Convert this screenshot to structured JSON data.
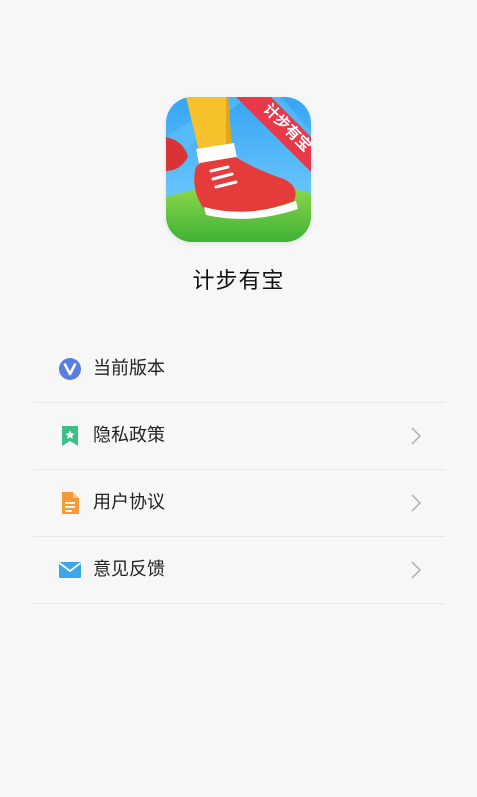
{
  "app": {
    "name": "计步有宝",
    "icon_banner_text": "计步有宝"
  },
  "menu": {
    "items": [
      {
        "label": "当前版本",
        "icon": "version-v-icon",
        "has_chevron": false
      },
      {
        "label": "隐私政策",
        "icon": "bookmark-icon",
        "has_chevron": true
      },
      {
        "label": "用户协议",
        "icon": "document-icon",
        "has_chevron": true
      },
      {
        "label": "意见反馈",
        "icon": "envelope-icon",
        "has_chevron": true
      }
    ]
  },
  "colors": {
    "background": "#f7f7f7",
    "divider": "#e8e8e8",
    "version_icon": "#5b7de0",
    "privacy_icon": "#3ebf87",
    "agreement_icon": "#f59a3a",
    "feedback_icon": "#3aa7e8",
    "chevron": "#b5b5b5"
  }
}
